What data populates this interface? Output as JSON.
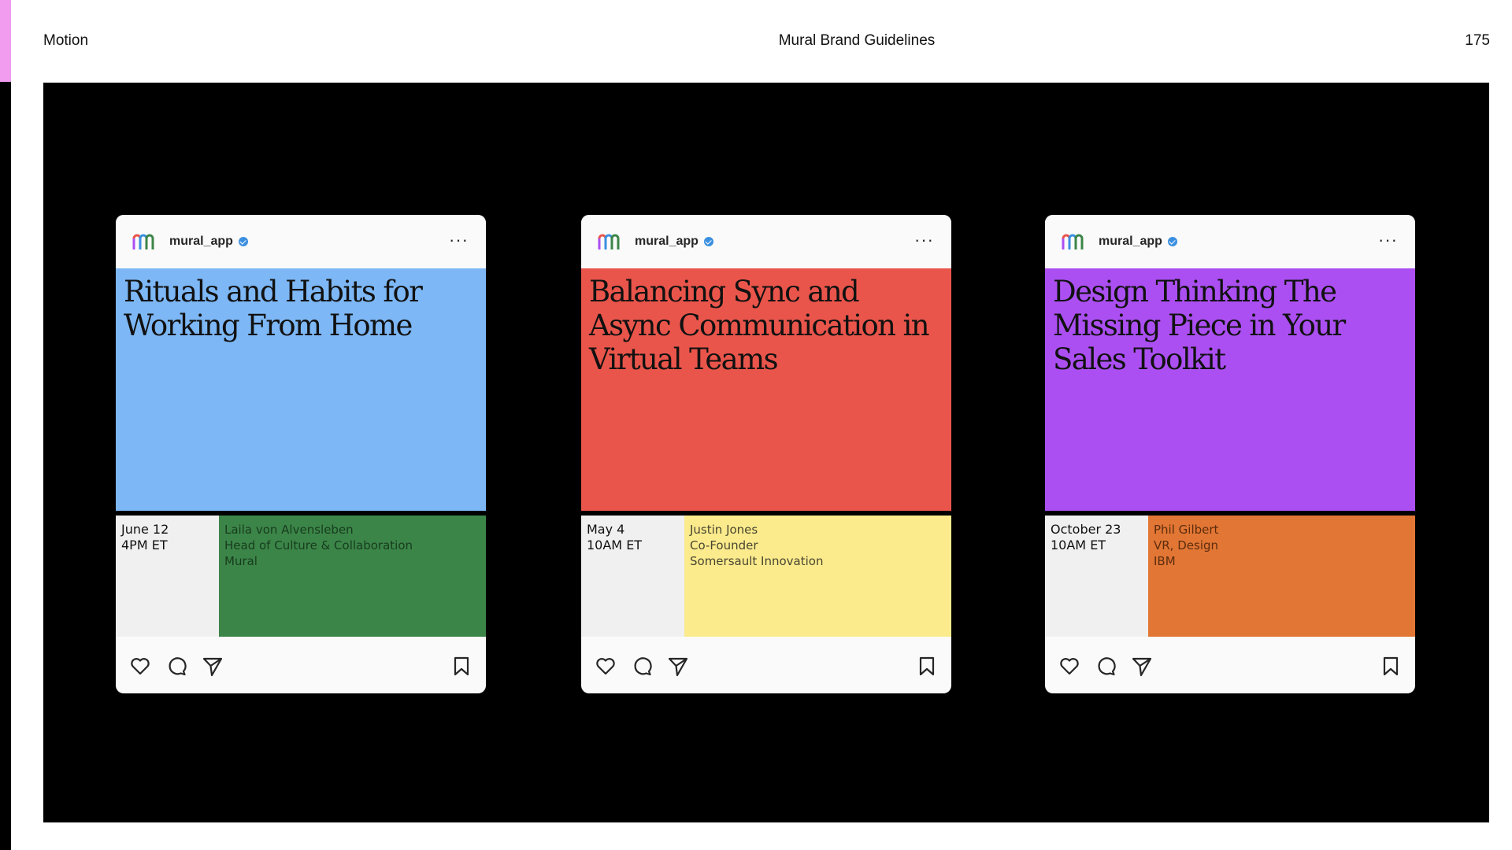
{
  "page": {
    "section": "Motion",
    "title": "Mural Brand Guidelines",
    "page_number": "175"
  },
  "colors": {
    "accent": "#f29cf0",
    "stage": "#000000"
  },
  "posts": [
    {
      "handle": "mural_app",
      "title": "Rituals and Habits for Working From Home",
      "date": "June 12\n4PM ET",
      "speaker": "Laila von Alvensleben\nHead of Culture & Collaboration\nMural",
      "hero_color": "#7db7f5",
      "speaker_color": "#3c8548",
      "speaker_text_color": "#0d2a14"
    },
    {
      "handle": "mural_app",
      "title": "Balancing Sync and Async Communication in Virtual Teams",
      "date": "May 4\n10AM ET",
      "speaker": "Justin Jones\nCo-Founder\nSomersault Innovation",
      "hero_color": "#e9554b",
      "speaker_color": "#fbeb8c",
      "speaker_text_color": "#1a1a1a"
    },
    {
      "handle": "mural_app",
      "title": "Design Thinking The Missing Piece in Your Sales Toolkit",
      "date": "October 23\n10AM ET",
      "speaker": "Phil Gilbert\nVR, Design\nIBM",
      "hero_color": "#ab4ff2",
      "speaker_color": "#e27634",
      "speaker_text_color": "#3a1a05"
    }
  ],
  "icons": [
    "heart-icon",
    "comment-icon",
    "send-icon",
    "bookmark-icon",
    "more-icon",
    "verified-icon",
    "mural-logo-icon"
  ]
}
